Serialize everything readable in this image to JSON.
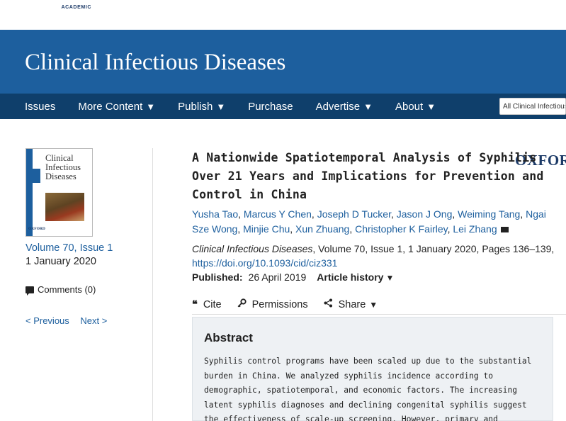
{
  "brand": {
    "name": "OXFORD",
    "sub": "ACADEMIC"
  },
  "journal": {
    "title": "Clinical Infectious Diseases"
  },
  "nav": {
    "items": [
      {
        "label": "Issues",
        "caret": ""
      },
      {
        "label": "More Content",
        "caret": "▼"
      },
      {
        "label": "Publish",
        "caret": "▼"
      },
      {
        "label": "Purchase",
        "caret": ""
      },
      {
        "label": "Advertise",
        "caret": "▼"
      },
      {
        "label": "About",
        "caret": "▼"
      }
    ],
    "search_value": "All Clinical Infectious Diseases"
  },
  "sidebar": {
    "cover_title": "Clinical Infectious Diseases",
    "cover_publisher": "OXFORD",
    "volume": "Volume 70, Issue 1",
    "date": "1 January 2020",
    "comments": "Comments (0)",
    "previous": "< Previous",
    "next": "Next >"
  },
  "article": {
    "title": "A Nationwide Spatiotemporal Analysis of Syphilis Over 21 Years and Implications for Prevention and Control in China",
    "authors": [
      "Yusha Tao",
      "Marcus Y Chen",
      "Joseph D Tucker",
      "Jason J Ong",
      "Weiming Tang",
      "Ngai Sze Wong",
      "Minjie Chu",
      "Xun Zhuang",
      "Christopher K Fairley",
      "Lei Zhang"
    ],
    "citation": {
      "journal": "Clinical Infectious Diseases",
      "details": ", Volume 70, Issue 1, 1 January 2020, Pages 136–139, ",
      "doi": "https://doi.org/10.1093/cid/ciz331"
    },
    "published_label": "Published:",
    "published_date": "26 April 2019",
    "history_label": "Article history",
    "history_caret": "▼"
  },
  "tools": {
    "cite": "Cite",
    "cite_icon": "❝",
    "permissions": "Permissions",
    "share": "Share",
    "share_caret": "▼"
  },
  "abstract": {
    "heading": "Abstract",
    "text": "Syphilis control programs have been scaled up due to the substantial burden in China. We analyzed syphilis incidence according to demographic, spatiotemporal, and economic factors. The increasing latent syphilis diagnoses and declining congenital syphilis suggest the effectiveness of scale-up screening. However, primary and secondary cases persist,"
  }
}
